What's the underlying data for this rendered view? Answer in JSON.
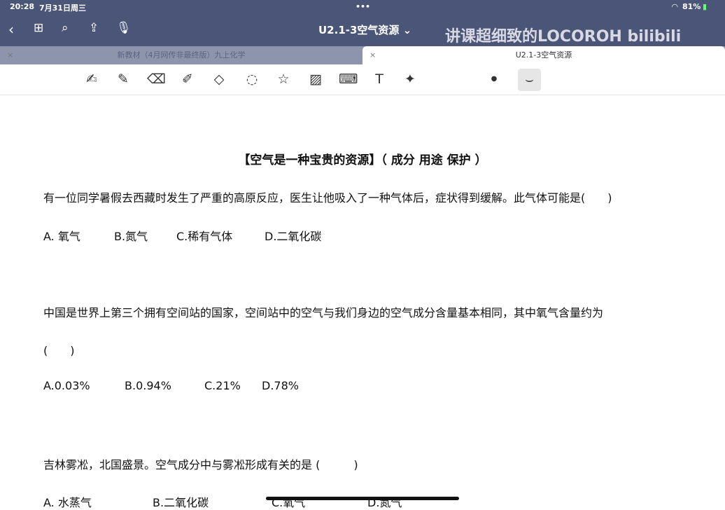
{
  "status": {
    "time": "20:28",
    "date": "7月31日周三",
    "battery": "81%"
  },
  "header": {
    "title": "U2.1-3空气资源 ⌄",
    "watermark": "讲课超细致的LOCOROH bilibili"
  },
  "tabs": [
    {
      "label": "新教材（4月网传非最终版）九上化学"
    },
    {
      "label": "U2.1-3空气资源"
    }
  ],
  "doc": {
    "heading": "【空气是一种宝贵的资源】（ 成分  用途  保护 ）",
    "q1": "有一位同学暑假去西藏时发生了严重的高原反应，医生让他吸入了一种气体后，症状得到缓解。此气体可能是(　　)",
    "q1_options": [
      "A.  氧气",
      "B.氮气",
      "C.稀有气体",
      "D.二氧化碳"
    ],
    "q2": "中国是世界上第三个拥有空间站的国家，空间站中的空气与我们身边的空气成分含量基本相同，其中氧气含量约为",
    "q2_paren": "(　　)",
    "q2_options": [
      "A.0.03%",
      "B.0.94%",
      "C.21%",
      "D.78%"
    ],
    "q3": "吉林雾凇，北国盛景。空气成分中与雾凇形成有关的是 (　　　)",
    "q3_options": [
      "A.  水蒸气",
      "B.二氧化碳",
      "C.氧气",
      "D.氮气"
    ]
  }
}
